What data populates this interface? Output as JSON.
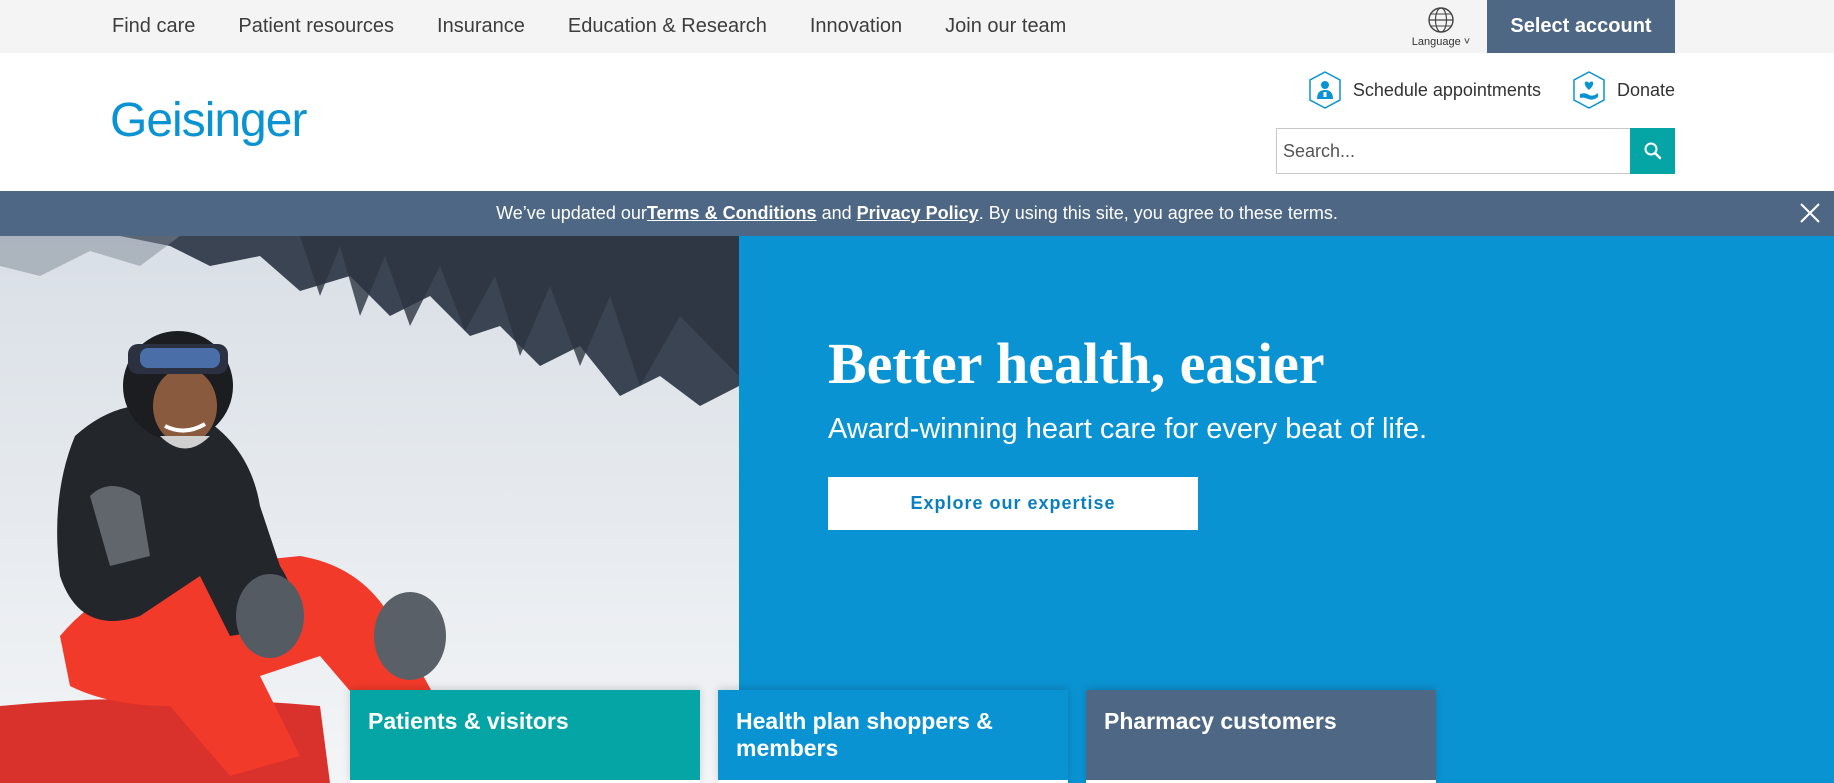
{
  "topnav": {
    "items": [
      "Find care",
      "Patient resources",
      "Insurance",
      "Education & Research",
      "Innovation",
      "Join our team"
    ],
    "language_label": "Language ˅",
    "select_account": "Select account"
  },
  "header": {
    "logo": "Geisinger",
    "schedule": "Schedule appointments",
    "donate": "Donate",
    "search_placeholder": "Search..."
  },
  "notice": {
    "before": "We’ve updated our ",
    "terms": "Terms & Conditions",
    "and": " and ",
    "privacy": "Privacy Policy",
    "after": ". By using this site, you agree to these terms."
  },
  "hero": {
    "title": "Better health, easier",
    "subtitle": "Award-winning heart care for every beat of life.",
    "cta": "Explore our expertise"
  },
  "cards": [
    {
      "label": "Patients & visitors"
    },
    {
      "label": "Health plan shoppers & members"
    },
    {
      "label": "Pharmacy customers"
    }
  ],
  "colors": {
    "brand_blue": "#0a93d2",
    "teal": "#05a5a5",
    "slate": "#4d6784"
  }
}
